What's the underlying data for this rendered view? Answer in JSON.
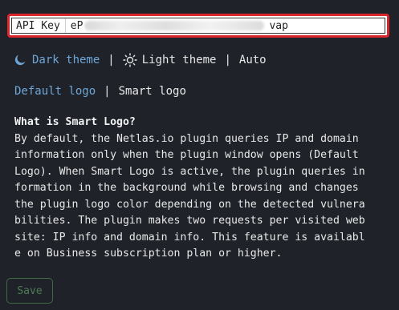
{
  "api_key": {
    "label": "API Key",
    "value_visible_prefix": "eP",
    "value_visible_suffix": "vap"
  },
  "theme": {
    "options": [
      {
        "label": "Dark theme",
        "active": true,
        "icon": "moon-icon"
      },
      {
        "label": "Light theme",
        "active": false,
        "icon": "sun-icon"
      },
      {
        "label": "Auto",
        "active": false
      }
    ],
    "separator": "|"
  },
  "logo": {
    "options": [
      {
        "label": "Default logo",
        "active": true
      },
      {
        "label": "Smart logo",
        "active": false
      }
    ],
    "separator": "|"
  },
  "info": {
    "title": "What is Smart Logo?",
    "lines": [
      "By default, the Netlas.io plugin queries IP and domain",
      "information only when the plugin window opens (Default",
      "Logo). When Smart Logo is active, the plugin queries in",
      "formation in the background while browsing and changes",
      "the plugin logo color depending on the detected vulnera",
      "bilities. The plugin makes two requests per visited web",
      "site: IP info and domain info. This feature is availabl",
      "e on Business subscription plan or higher."
    ]
  },
  "save_button": {
    "label": "Save"
  },
  "colors": {
    "background": "#1f2329",
    "accent": "#6fa6d8",
    "highlight_border": "#d7262e",
    "save_text": "#4d7d54"
  }
}
